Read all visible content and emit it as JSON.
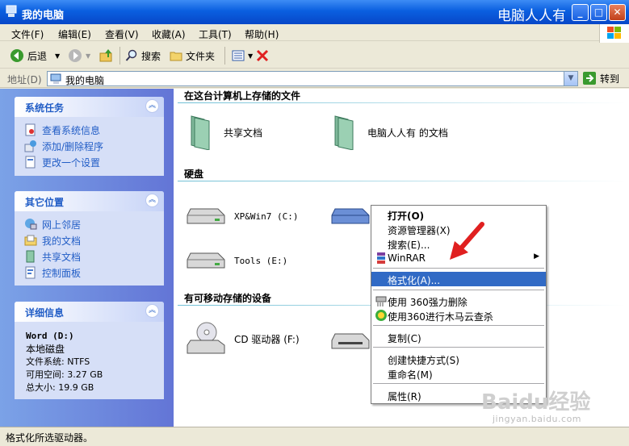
{
  "window": {
    "title": "我的电脑",
    "watermark_text": "电脑人人有"
  },
  "menu": [
    "文件(F)",
    "编辑(E)",
    "查看(V)",
    "收藏(A)",
    "工具(T)",
    "帮助(H)"
  ],
  "toolbar": {
    "back": "后退",
    "search": "搜索",
    "folders": "文件夹"
  },
  "address": {
    "label": "地址(D)",
    "value": "我的电脑",
    "go": "转到"
  },
  "sidebar": {
    "system_tasks": {
      "title": "系统任务",
      "items": [
        "查看系统信息",
        "添加/删除程序",
        "更改一个设置"
      ]
    },
    "other_places": {
      "title": "其它位置",
      "items": [
        "网上邻居",
        "我的文档",
        "共享文档",
        "控制面板"
      ]
    },
    "details": {
      "title": "详细信息",
      "name": "Word (D:)",
      "type": "本地磁盘",
      "fs": "文件系统: NTFS",
      "free": "可用空间: 3.27 GB",
      "total": "总大小: 19.9 GB"
    }
  },
  "content": {
    "group_files": "在这台计算机上存储的文件",
    "shared_docs": "共享文档",
    "user_docs": "电脑人人有 的文档",
    "group_disks": "硬盘",
    "disk_c": "XP&Win7 (C:)",
    "disk_e": "Tools (E:)",
    "group_removable": "有可移动存储的设备",
    "cd_drive": "CD 驱动器 (F:)"
  },
  "context_menu": {
    "items": [
      "打开(O)",
      "资源管理器(X)",
      "搜索(E)...",
      "WinRAR",
      "格式化(A)...",
      "使用 360强力删除",
      "使用360进行木马云查杀",
      "复制(C)",
      "创建快捷方式(S)",
      "重命名(M)",
      "属性(R)"
    ],
    "highlighted": "格式化(A)..."
  },
  "status": "格式化所选驱动器。",
  "watermark": {
    "brand": "Baidu经验",
    "url": "jingyan.baidu.com"
  },
  "colors": {
    "titlebar": "#0a5fe0",
    "sidebar_bg": "#6375d6",
    "highlight": "#316ac5",
    "arrow": "#e02020"
  }
}
